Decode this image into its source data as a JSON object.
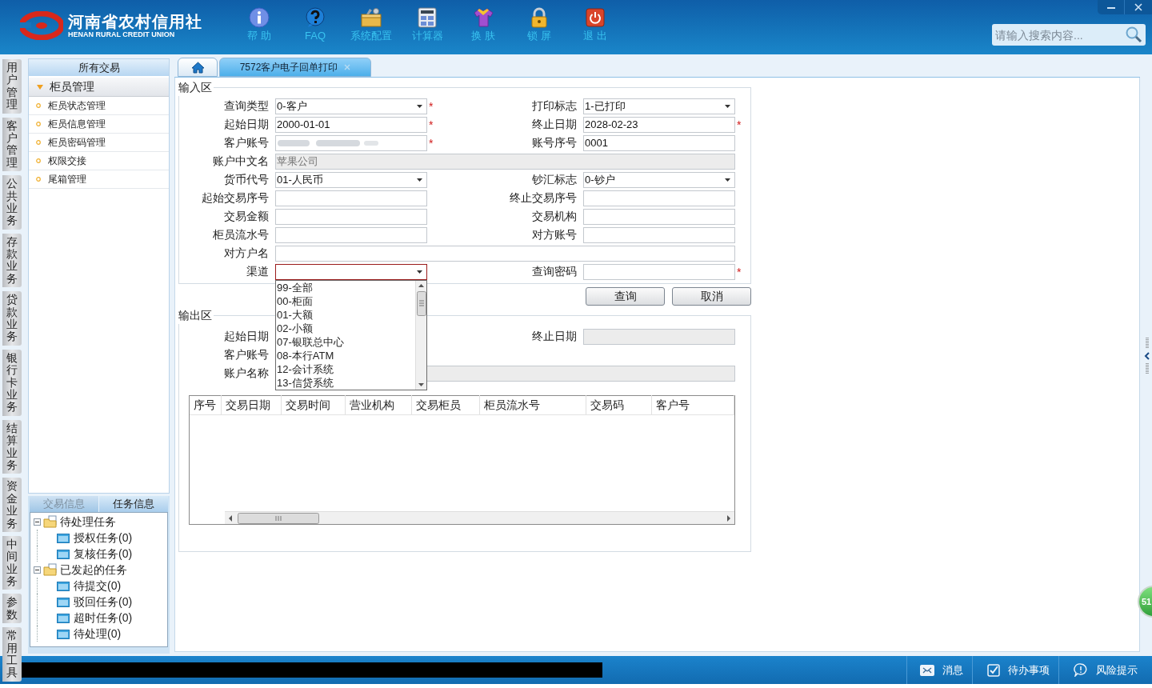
{
  "header": {
    "logo_title": "河南省农村信用社",
    "logo_subtitle": "HENAN RURAL CREDIT UNION",
    "toolbar": [
      {
        "kind": "help",
        "label": "帮 助"
      },
      {
        "kind": "faq",
        "label": "FAQ"
      },
      {
        "kind": "config",
        "label": "系统配置"
      },
      {
        "kind": "calculator",
        "label": "计算器"
      },
      {
        "kind": "skin",
        "label": "换 肤"
      },
      {
        "kind": "lock",
        "label": "锁 屏"
      },
      {
        "kind": "exit",
        "label": "退 出"
      }
    ],
    "search": {
      "placeholder": "请输入搜索内容..."
    }
  },
  "side_tabs": [
    "用户管理",
    "客户管理",
    "公共业务",
    "存款业务",
    "贷款业务",
    "银行卡业务",
    "结算业务",
    "资金业务",
    "中间业务",
    "参数",
    "常用工具"
  ],
  "sidebar": {
    "title": "所有交易",
    "group": {
      "label": "柜员管理",
      "expanded": true
    },
    "items": [
      "柜员状态管理",
      "柜员信息管理",
      "柜员密码管理",
      "权限交接",
      "尾箱管理"
    ]
  },
  "lower_panel": {
    "tabs": [
      {
        "label": "交易信息",
        "selected": false
      },
      {
        "label": "任务信息",
        "selected": true
      }
    ],
    "tree": [
      {
        "label": "待处理任务",
        "expanded": true,
        "children": [
          {
            "label": "授权任务(0)"
          },
          {
            "label": "复核任务(0)"
          }
        ]
      },
      {
        "label": "已发起的任务",
        "expanded": true,
        "children": [
          {
            "label": "待提交(0)"
          },
          {
            "label": "驳回任务(0)"
          },
          {
            "label": "超时任务(0)"
          },
          {
            "label": "待处理(0)"
          }
        ]
      }
    ]
  },
  "tabs": [
    {
      "kind": "home",
      "selected": false
    },
    {
      "kind": "page",
      "label": "7572客户电子回单打印",
      "selected": true
    }
  ],
  "input_area": {
    "title": "输入区",
    "rows": [
      [
        {
          "label": "查询类型",
          "kind": "select",
          "value": "0-客户",
          "mark": "*",
          "focused": false
        },
        {
          "label": "打印标志",
          "kind": "select",
          "value": "1-已打印",
          "focused": false
        }
      ],
      [
        {
          "label": "起始日期",
          "kind": "text",
          "value": "2000-01-01",
          "mark": "*",
          "focused": false
        },
        {
          "label": "终止日期",
          "kind": "text",
          "value": "2028-02-23",
          "mark": "*",
          "focused": false
        }
      ],
      [
        {
          "label": "客户账号",
          "kind": "masked",
          "mark": "*",
          "focused": false
        },
        {
          "label": "账号序号",
          "kind": "text",
          "value": "0001",
          "focused": false
        }
      ],
      [
        {
          "label": "账户中文名",
          "kind": "readonly",
          "value": "苹果公司",
          "focused": false
        }
      ],
      [
        {
          "label": "货币代号",
          "kind": "select",
          "value": "01-人民币",
          "focused": false
        },
        {
          "label": "钞汇标志",
          "kind": "select",
          "value": "0-钞户",
          "focused": false
        }
      ],
      [
        {
          "label": "起始交易序号",
          "kind": "text",
          "focused": false
        },
        {
          "label": "终止交易序号",
          "kind": "text",
          "focused": false
        }
      ],
      [
        {
          "label": "交易金额",
          "kind": "text",
          "focused": false
        },
        {
          "label": "交易机构",
          "kind": "text",
          "focused": false
        }
      ],
      [
        {
          "label": "柜员流水号",
          "kind": "text",
          "focused": false
        },
        {
          "label": "对方账号",
          "kind": "text",
          "focused": false
        }
      ],
      [
        {
          "label": "对方户名",
          "kind": "text",
          "focused": false
        }
      ],
      [
        {
          "label": "渠道",
          "kind": "select",
          "focused": true,
          "open": true
        },
        {
          "label": "查询密码",
          "kind": "text",
          "mark": "*",
          "focused": false
        }
      ]
    ]
  },
  "channel_options": [
    "99-全部",
    "00-柜面",
    "01-大额",
    "02-小额",
    "07-银联总中心",
    "08-本行ATM",
    "12-会计系统",
    "13-信贷系统"
  ],
  "buttons": [
    "查询",
    "取消"
  ],
  "output_area": {
    "title": "输出区",
    "fields": [
      {
        "label": "起始日期",
        "kind": "covered"
      },
      {
        "label": "终止日期",
        "kind": "readonly"
      },
      {
        "label": "客户账号",
        "kind": "covered"
      },
      {
        "label": "账户名称",
        "kind": "readonly"
      }
    ],
    "columns": [
      "序号",
      "交易日期",
      "交易时间",
      "营业机构",
      "交易柜员",
      "柜员流水号",
      "交易码",
      "客户号"
    ]
  },
  "float_badge": "51",
  "status_bar": [
    {
      "kind": "message",
      "label": "消息"
    },
    {
      "kind": "todo",
      "label": "待办事项"
    },
    {
      "kind": "risk",
      "label": "风险提示"
    }
  ]
}
